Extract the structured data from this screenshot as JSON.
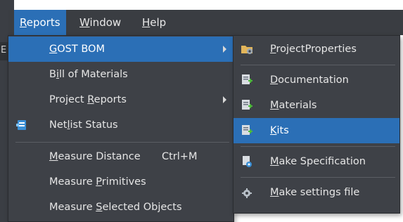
{
  "menubar": {
    "items": [
      {
        "pre": "",
        "ul": "R",
        "post": "eports"
      },
      {
        "pre": "",
        "ul": "W",
        "post": "indow"
      },
      {
        "pre": "",
        "ul": "H",
        "post": "elp"
      }
    ]
  },
  "edge_label": "E",
  "reports_menu": {
    "items": [
      {
        "pre": "",
        "ul": "G",
        "post": "OST BOM"
      },
      {
        "pre": "B",
        "ul": "i",
        "post": "ll of Materials"
      },
      {
        "pre": "Project ",
        "ul": "R",
        "post": "eports"
      },
      {
        "pre": "Net",
        "ul": "l",
        "post": "ist Status"
      },
      {
        "pre": "",
        "ul": "M",
        "post": "easure Distance",
        "shortcut": "Ctrl+M"
      },
      {
        "pre": "Measure ",
        "ul": "P",
        "post": "rimitives"
      },
      {
        "pre": "Measure ",
        "ul": "S",
        "post": "elected Objects"
      }
    ]
  },
  "gost_submenu": {
    "items": [
      {
        "pre": "",
        "ul": "P",
        "post": "rojectProperties",
        "icon": "folder-gear-icon"
      },
      {
        "pre": "",
        "ul": "D",
        "post": "ocumentation",
        "icon": "document-add-icon"
      },
      {
        "pre": "",
        "ul": "M",
        "post": "aterials",
        "icon": "document-add-icon"
      },
      {
        "pre": "",
        "ul": "K",
        "post": "its",
        "icon": "document-add-icon"
      },
      {
        "pre": "",
        "ul": "M",
        "post": "ake Specification",
        "icon": "document-settings-icon"
      },
      {
        "pre": "",
        "ul": "M",
        "post": "ake settings file",
        "icon": "gear-icon"
      }
    ]
  },
  "colors": {
    "highlight": "#2b6fb6",
    "menu_bg": "#3e4147",
    "menubar_bg": "#3a3d42"
  }
}
